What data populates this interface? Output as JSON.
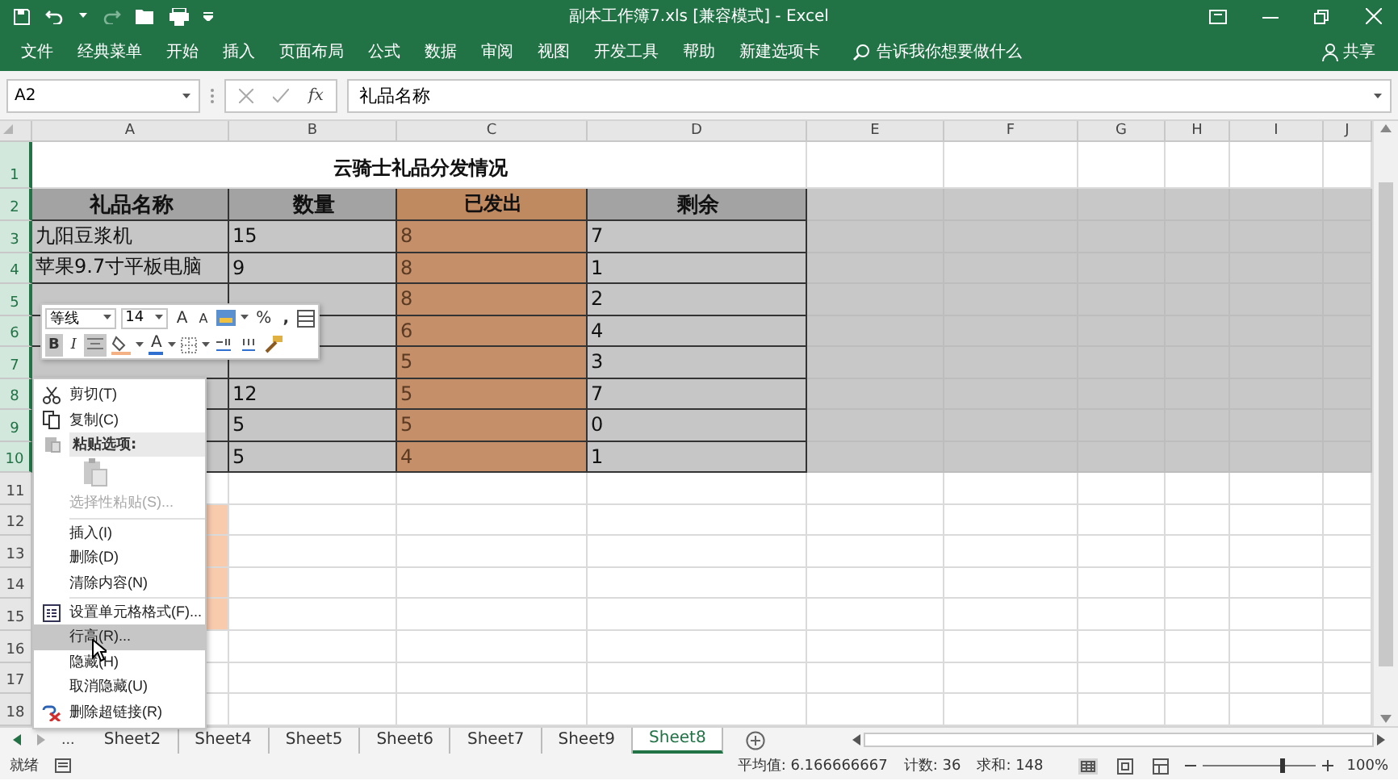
{
  "window": {
    "title": "副本工作簿7.xls  [兼容模式]  -  Excel"
  },
  "ribbon_tabs": [
    {
      "label": "文件",
      "selected": false
    },
    {
      "label": "经典菜单",
      "selected": false
    },
    {
      "label": "开始",
      "selected": false
    },
    {
      "label": "插入",
      "selected": false
    },
    {
      "label": "页面布局",
      "selected": false
    },
    {
      "label": "公式",
      "selected": false
    },
    {
      "label": "数据",
      "selected": false
    },
    {
      "label": "审阅",
      "selected": false
    },
    {
      "label": "视图",
      "selected": false
    },
    {
      "label": "开发工具",
      "selected": false
    },
    {
      "label": "帮助",
      "selected": false
    },
    {
      "label": "新建选项卡",
      "selected": false
    }
  ],
  "tell_me": "告诉我你想要做什么",
  "share": "共享",
  "formula_bar": {
    "name_box": "A2",
    "fx": "fx",
    "value": "礼品名称"
  },
  "columns": [
    "A",
    "B",
    "C",
    "D",
    "E",
    "F",
    "G",
    "H",
    "I",
    "J"
  ],
  "rows": [
    {
      "number": "1",
      "selected": true,
      "cells": [
        {
          "kind": "title",
          "text": "云骑士礼品分发情况"
        },
        {
          "kind": "blank"
        },
        {
          "kind": "blank"
        },
        {
          "kind": "blank"
        },
        {
          "kind": "blank"
        },
        {
          "kind": "blank"
        },
        {
          "kind": "blank"
        }
      ]
    },
    {
      "number": "2",
      "selected": true,
      "cells": [
        {
          "kind": "head",
          "text": "礼品名称"
        },
        {
          "kind": "head",
          "text": "数量"
        },
        {
          "kind": "head-sent",
          "text": "已发出"
        },
        {
          "kind": "head",
          "text": "剩余"
        },
        {
          "kind": "sel"
        },
        {
          "kind": "sel"
        },
        {
          "kind": "sel"
        },
        {
          "kind": "sel"
        },
        {
          "kind": "sel"
        },
        {
          "kind": "sel"
        }
      ]
    },
    {
      "number": "3",
      "selected": true,
      "cells": [
        {
          "kind": "val",
          "text": "九阳豆浆机"
        },
        {
          "kind": "val",
          "text": "15"
        },
        {
          "kind": "sent",
          "text": "8"
        },
        {
          "kind": "val",
          "text": "7"
        },
        {
          "kind": "sel"
        },
        {
          "kind": "sel"
        },
        {
          "kind": "sel"
        },
        {
          "kind": "sel"
        },
        {
          "kind": "sel"
        },
        {
          "kind": "sel"
        }
      ]
    },
    {
      "number": "4",
      "selected": true,
      "cells": [
        {
          "kind": "val",
          "text": "苹果9.7寸平板电脑"
        },
        {
          "kind": "val",
          "text": "9"
        },
        {
          "kind": "sent",
          "text": "8"
        },
        {
          "kind": "val",
          "text": "1"
        },
        {
          "kind": "sel"
        },
        {
          "kind": "sel"
        },
        {
          "kind": "sel"
        },
        {
          "kind": "sel"
        },
        {
          "kind": "sel"
        },
        {
          "kind": "sel"
        }
      ]
    },
    {
      "number": "5",
      "selected": true,
      "cells": [
        {
          "kind": "val"
        },
        {
          "kind": "val"
        },
        {
          "kind": "sent",
          "text": "8"
        },
        {
          "kind": "val",
          "text": "2"
        },
        {
          "kind": "sel"
        },
        {
          "kind": "sel"
        },
        {
          "kind": "sel"
        },
        {
          "kind": "sel"
        },
        {
          "kind": "sel"
        },
        {
          "kind": "sel"
        }
      ]
    },
    {
      "number": "6",
      "selected": true,
      "cells": [
        {
          "kind": "val"
        },
        {
          "kind": "val"
        },
        {
          "kind": "sent",
          "text": "6"
        },
        {
          "kind": "val",
          "text": "4"
        },
        {
          "kind": "sel"
        },
        {
          "kind": "sel"
        },
        {
          "kind": "sel"
        },
        {
          "kind": "sel"
        },
        {
          "kind": "sel"
        },
        {
          "kind": "sel"
        }
      ]
    },
    {
      "number": "7",
      "selected": true,
      "cells": [
        {
          "kind": "val"
        },
        {
          "kind": "val"
        },
        {
          "kind": "sent",
          "text": "5"
        },
        {
          "kind": "val",
          "text": "3"
        },
        {
          "kind": "sel"
        },
        {
          "kind": "sel"
        },
        {
          "kind": "sel"
        },
        {
          "kind": "sel"
        },
        {
          "kind": "sel"
        },
        {
          "kind": "sel"
        }
      ]
    },
    {
      "number": "8",
      "selected": true,
      "cells": [
        {
          "kind": "val"
        },
        {
          "kind": "val",
          "text": "12"
        },
        {
          "kind": "sent",
          "text": "5"
        },
        {
          "kind": "val",
          "text": "7"
        },
        {
          "kind": "sel"
        },
        {
          "kind": "sel"
        },
        {
          "kind": "sel"
        },
        {
          "kind": "sel"
        },
        {
          "kind": "sel"
        },
        {
          "kind": "sel"
        }
      ]
    },
    {
      "number": "9",
      "selected": true,
      "cells": [
        {
          "kind": "val"
        },
        {
          "kind": "val",
          "text": "5"
        },
        {
          "kind": "sent",
          "text": "5"
        },
        {
          "kind": "val",
          "text": "0"
        },
        {
          "kind": "sel"
        },
        {
          "kind": "sel"
        },
        {
          "kind": "sel"
        },
        {
          "kind": "sel"
        },
        {
          "kind": "sel"
        },
        {
          "kind": "sel"
        }
      ]
    },
    {
      "number": "10",
      "selected": true,
      "cells": [
        {
          "kind": "val"
        },
        {
          "kind": "val",
          "text": "5"
        },
        {
          "kind": "sent",
          "text": "4"
        },
        {
          "kind": "val",
          "text": "1"
        },
        {
          "kind": "sel"
        },
        {
          "kind": "sel"
        },
        {
          "kind": "sel"
        },
        {
          "kind": "sel"
        },
        {
          "kind": "sel"
        },
        {
          "kind": "sel"
        }
      ]
    },
    {
      "number": "11",
      "selected": false,
      "cells": []
    },
    {
      "number": "12",
      "selected": false,
      "cells": [
        {
          "kind": "peach"
        }
      ]
    },
    {
      "number": "13",
      "selected": false,
      "cells": [
        {
          "kind": "peach"
        }
      ]
    },
    {
      "number": "14",
      "selected": false,
      "cells": [
        {
          "kind": "peach"
        }
      ]
    },
    {
      "number": "15",
      "selected": false,
      "cells": [
        {
          "kind": "peach"
        }
      ]
    },
    {
      "number": "16",
      "selected": false,
      "cells": []
    },
    {
      "number": "17",
      "selected": false,
      "cells": []
    },
    {
      "number": "18",
      "selected": false,
      "cells": []
    }
  ],
  "mini_toolbar": {
    "font": "等线",
    "size": "14",
    "grow_label": "A",
    "shrink_label": "A",
    "percent": "%",
    "comma": ",",
    "bold_label": "B",
    "bold_on": true,
    "italic_label": "I",
    "center_on": true,
    "font_color_label": "A"
  },
  "context_menu": [
    {
      "kind": "cut",
      "label": "剪切(T)",
      "disabled": false,
      "selected": false
    },
    {
      "kind": "copy",
      "label": "复制(C)",
      "disabled": false,
      "selected": false
    },
    {
      "kind": "heading",
      "label": "粘贴选项:"
    },
    {
      "kind": "paste"
    },
    {
      "kind": "plain",
      "label": "选择性粘贴(S)...",
      "disabled": true,
      "selected": false
    },
    {
      "kind": "separator"
    },
    {
      "kind": "plain",
      "label": "插入(I)",
      "disabled": false,
      "selected": false
    },
    {
      "kind": "plain",
      "label": "删除(D)",
      "disabled": false,
      "selected": false
    },
    {
      "kind": "plain",
      "label": "清除内容(N)",
      "disabled": false,
      "selected": false
    },
    {
      "kind": "separator"
    },
    {
      "kind": "format",
      "label": "设置单元格格式(F)...",
      "disabled": false,
      "selected": false
    },
    {
      "kind": "plain",
      "label": "行高(R)...",
      "disabled": false,
      "selected": true
    },
    {
      "kind": "plain",
      "label": "隐藏(H)",
      "disabled": false,
      "selected": false
    },
    {
      "kind": "plain",
      "label": "取消隐藏(U)",
      "disabled": false,
      "selected": false
    },
    {
      "kind": "unlink",
      "label": "删除超链接(R)",
      "disabled": false,
      "selected": false
    }
  ],
  "sheet_nav": "...",
  "sheets": [
    {
      "label": "Sheet2",
      "selected": false
    },
    {
      "label": "Sheet4",
      "selected": false
    },
    {
      "label": "Sheet5",
      "selected": false
    },
    {
      "label": "Sheet6",
      "selected": false
    },
    {
      "label": "Sheet7",
      "selected": false
    },
    {
      "label": "Sheet9",
      "selected": false
    },
    {
      "label": "Sheet8",
      "selected": true
    }
  ],
  "status_bar": {
    "mode": "就绪",
    "average": "平均值: 6.166666667",
    "count": "计数: 36",
    "sum": "求和: 148",
    "zoom": {
      "level": 0.7
    },
    "zoom_text": "100%"
  }
}
